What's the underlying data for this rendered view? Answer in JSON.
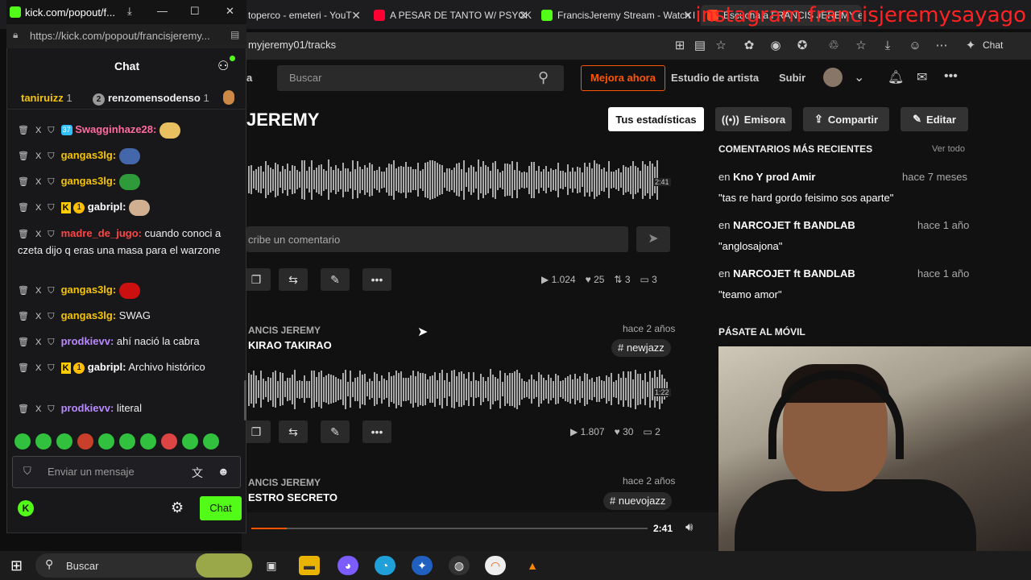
{
  "tabs": [
    {
      "label": "toperco - emeteri - YouT",
      "favicon": "youtube"
    },
    {
      "label": "A PESAR DE TANTO W/ PSYCKE",
      "favicon": "youtube"
    },
    {
      "label": "FrancisJeremy Stream - Watch l",
      "favicon": "kick"
    },
    {
      "label": "Escucha a FRANCIS JEREMY en",
      "favicon": "bandlab"
    }
  ],
  "overlay_text": "instagram francisjeremysayago",
  "address": {
    "url_rest": "myjeremy01/tracks"
  },
  "browser": {
    "chat_label": "Chat"
  },
  "header": {
    "search_placeholder": "Buscar",
    "upgrade_label": "Mejora ahora",
    "studio_label": "Estudio de artista",
    "upload_label": "Subir",
    "partial_nav": "a"
  },
  "profile": {
    "name": "JEREMY",
    "buttons": {
      "stats": "Tus estadísticas",
      "station": "Emisora",
      "share": "Compartir",
      "edit": "Editar"
    }
  },
  "track1": {
    "time": "2:41",
    "comment_placeholder": "cribe un comentario",
    "stats": {
      "plays": "1.024",
      "likes": "25",
      "reposts": "3",
      "comments": "3"
    }
  },
  "track2": {
    "artist": "ANCIS JEREMY",
    "title": "KIRAO TAKIRAO",
    "date": "hace 2 años",
    "tag": "# newjazz",
    "time": "1:22",
    "stats": {
      "plays": "1.807",
      "likes": "30",
      "comments": "2"
    }
  },
  "track3": {
    "artist": "ANCIS JEREMY",
    "title": "ESTRO SECRETO",
    "date": "hace 2 años",
    "tag": "# nuevojazz"
  },
  "sidebar": {
    "recent_title": "COMENTARIOS MÁS RECIENTES",
    "view_all": "Ver todo",
    "comments": [
      {
        "prefix": "en",
        "track": "Kno Y prod Amir",
        "date": "hace 7 meses",
        "text": "\"tas re hard gordo feisimo sos aparte\""
      },
      {
        "prefix": "en",
        "track": "NARCOJET ft BANDLAB",
        "date": "hace 1 año",
        "text": "\"anglosajona\""
      },
      {
        "prefix": "en",
        "track": "NARCOJET ft BANDLAB",
        "date": "hace 1 año",
        "text": "\"teamo amor\""
      }
    ],
    "mobile_title": "PÁSATE AL MÓVIL"
  },
  "player": {
    "time": "2:41",
    "progress": 0.09
  },
  "kick": {
    "window_title": "kick.com/popout/f...",
    "url": "https://kick.com/popout/francisjeremy...",
    "chat_title": "Chat",
    "gifters": [
      {
        "name": "taniruizz",
        "count": "1",
        "rank": ""
      },
      {
        "name": "renzomensodenso",
        "count": "1",
        "rank": "2"
      }
    ],
    "messages": [
      {
        "user": "Swagginhaze28:",
        "color": "#ff6b9d",
        "text": "",
        "badges": "sub",
        "sub_months": "37",
        "emote": true
      },
      {
        "user": "gangas3lg:",
        "color": "#f5c400",
        "text": "",
        "badges": "",
        "emote": true
      },
      {
        "user": "gangas3lg:",
        "color": "#f5c400",
        "text": "",
        "badges": "",
        "emote": true
      },
      {
        "user": "gabripl:",
        "color": "#ffffff",
        "text": "",
        "badges": "kg",
        "gift_count": "1",
        "emote": true
      },
      {
        "user": "madre_de_jugo:",
        "color": "#ff4444",
        "text": " cuando conoci a czeta dijo q eras una masa para el warzone",
        "badges": ""
      },
      {
        "user": "gangas3lg:",
        "color": "#f5c400",
        "text": "",
        "badges": "",
        "emote": true
      },
      {
        "user": "gangas3lg:",
        "color": "#f5c400",
        "text": " SWAG",
        "badges": ""
      },
      {
        "user": "prodkievv:",
        "color": "#b98aff",
        "text": " ahí nació la cabra",
        "badges": ""
      },
      {
        "user": "gabripl:",
        "color": "#ffffff",
        "text": " Archivo histórico",
        "badges": "kg",
        "gift_count": "1"
      },
      {
        "user": "prodkievv:",
        "color": "#b98aff",
        "text": " literal",
        "badges": ""
      }
    ],
    "input_placeholder": "Enviar un mensaje",
    "chat_button": "Chat"
  },
  "taskbar": {
    "search_label": "Buscar"
  },
  "colors": {
    "kick_green": "#53fc18",
    "bandlab_orange": "#ff5500"
  }
}
